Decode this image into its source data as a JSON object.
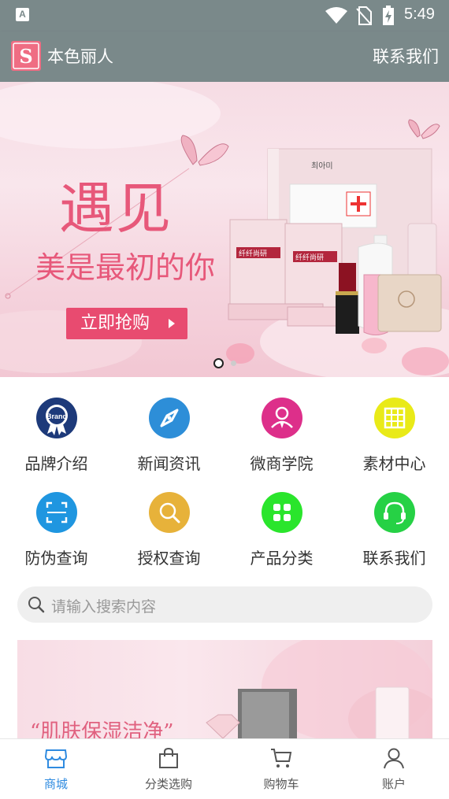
{
  "status_bar": {
    "time": "5:49",
    "app_indicator": "A"
  },
  "app_bar": {
    "title": "本色丽人",
    "contact_label": "联系我们",
    "logo_letter": "S"
  },
  "banner": {
    "headline": "遇见",
    "subline": "美是最初的你",
    "cta": "立即抢购",
    "product_texts": [
      "최아미",
      "纤纤尚研",
      "纤纤尚研"
    ],
    "page_count": 2,
    "active_page": 1
  },
  "grid": {
    "items": [
      {
        "label": "品牌介绍",
        "icon": "brand-badge-icon",
        "color": "#1d3a7a",
        "icon_text": "Brand"
      },
      {
        "label": "新闻资讯",
        "icon": "compass-icon",
        "color": "#2d8ed8"
      },
      {
        "label": "微商学院",
        "icon": "person-icon",
        "color": "#dd2f8a"
      },
      {
        "label": "素材中心",
        "icon": "material-grid-icon",
        "color": "#e9ea18"
      },
      {
        "label": "防伪查询",
        "icon": "scan-icon",
        "color": "#1f96e0"
      },
      {
        "label": "授权查询",
        "icon": "magnifier-icon",
        "color": "#e7b23a"
      },
      {
        "label": "产品分类",
        "icon": "category-icon",
        "color": "#2ae52c"
      },
      {
        "label": "联系我们",
        "icon": "headset-icon",
        "color": "#26d145"
      }
    ]
  },
  "search": {
    "placeholder": "请输入搜索内容"
  },
  "promo": {
    "text": "“肌肤保湿洁净”"
  },
  "tabs": [
    {
      "label": "商城",
      "icon": "store-icon",
      "active": true
    },
    {
      "label": "分类选购",
      "icon": "bag-icon",
      "active": false
    },
    {
      "label": "购物车",
      "icon": "cart-icon",
      "active": false
    },
    {
      "label": "账户",
      "icon": "user-icon",
      "active": false
    }
  ],
  "colors": {
    "app_bar": "#7a898a",
    "accent": "#e84b70",
    "tab_active": "#2f8be0"
  }
}
